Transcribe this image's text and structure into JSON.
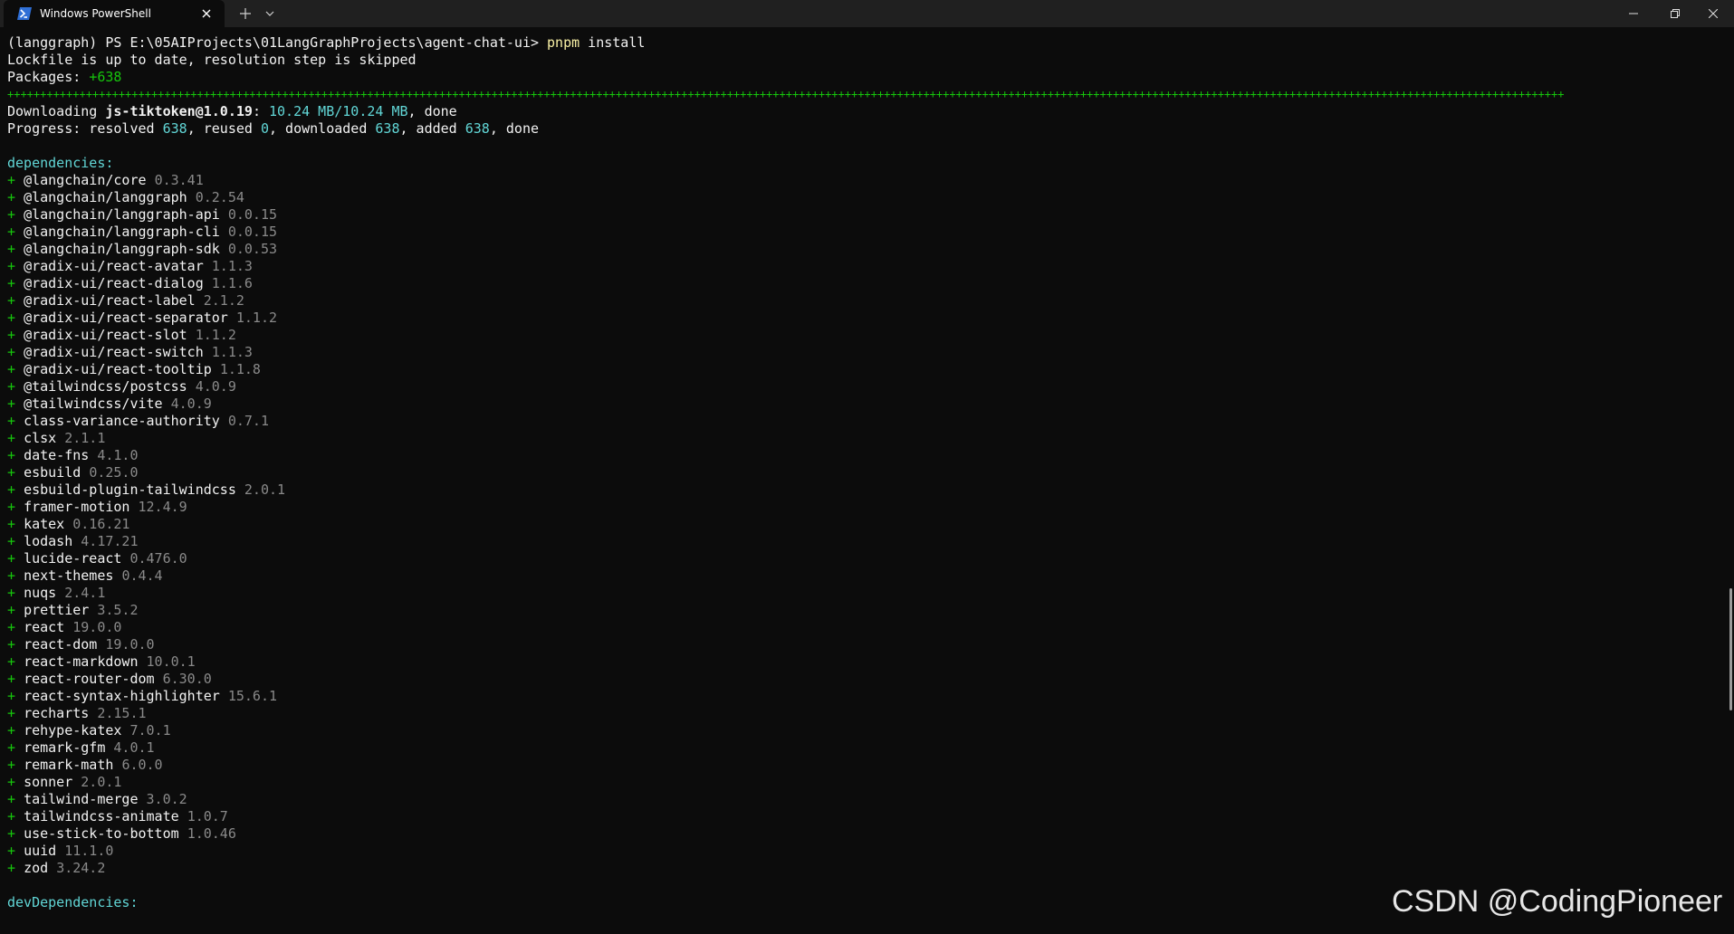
{
  "window": {
    "tab_title": "Windows PowerShell",
    "icons": {
      "tab": "powershell-icon",
      "close_tab": "close-icon",
      "new_tab": "plus-icon",
      "dropdown": "chevron-down-icon",
      "minimize": "minimize-icon",
      "maximize": "restore-icon",
      "close": "close-icon"
    }
  },
  "colors": {
    "background": "#0c0c0c",
    "titlebar": "#202020",
    "default_text": "#cccccc",
    "white_text": "#f2f2f2",
    "yellow": "#f9f1a5",
    "green": "#16c60c",
    "cyan": "#61d6d6",
    "dim": "#8a8a8a"
  },
  "terminal": {
    "prompt": "(langgraph) PS E:\\05AIProjects\\01LangGraphProjects\\agent-chat-ui> ",
    "command": "pnpm",
    "command_args": " install",
    "lockfile_line": "Lockfile is up to date, resolution step is skipped",
    "packages_label": "Packages: ",
    "packages_count": "+638",
    "plus_bar": "++++++++++++++++++++++++++++++++++++++++++++++++++++++++++++++++++++++++++++++++++++++++++++++++++++++++++++++++++++++++++++++++++++++++++++++++++++++++++++++++++++++++++++++++++++++++++++++++++++++++++++++++++++++++++++++++++++++++++++++",
    "downloading": {
      "label": "Downloading ",
      "package": "js-tiktoken@1.0.19",
      "sep": ": ",
      "progress": "10.24 MB/10.24 MB",
      "tail": ", done"
    },
    "progress_line": {
      "label": "Progress: resolved ",
      "resolved": "638",
      "reused_label": ", reused ",
      "reused": "0",
      "downloaded_label": ", downloaded ",
      "downloaded": "638",
      "added_label": ", added ",
      "added": "638",
      "tail": ", done"
    },
    "dependencies_header": "dependencies:",
    "dependencies": [
      {
        "name": "@langchain/core",
        "version": "0.3.41"
      },
      {
        "name": "@langchain/langgraph",
        "version": "0.2.54"
      },
      {
        "name": "@langchain/langgraph-api",
        "version": "0.0.15"
      },
      {
        "name": "@langchain/langgraph-cli",
        "version": "0.0.15"
      },
      {
        "name": "@langchain/langgraph-sdk",
        "version": "0.0.53"
      },
      {
        "name": "@radix-ui/react-avatar",
        "version": "1.1.3"
      },
      {
        "name": "@radix-ui/react-dialog",
        "version": "1.1.6"
      },
      {
        "name": "@radix-ui/react-label",
        "version": "2.1.2"
      },
      {
        "name": "@radix-ui/react-separator",
        "version": "1.1.2"
      },
      {
        "name": "@radix-ui/react-slot",
        "version": "1.1.2"
      },
      {
        "name": "@radix-ui/react-switch",
        "version": "1.1.3"
      },
      {
        "name": "@radix-ui/react-tooltip",
        "version": "1.1.8"
      },
      {
        "name": "@tailwindcss/postcss",
        "version": "4.0.9"
      },
      {
        "name": "@tailwindcss/vite",
        "version": "4.0.9"
      },
      {
        "name": "class-variance-authority",
        "version": "0.7.1"
      },
      {
        "name": "clsx",
        "version": "2.1.1"
      },
      {
        "name": "date-fns",
        "version": "4.1.0"
      },
      {
        "name": "esbuild",
        "version": "0.25.0"
      },
      {
        "name": "esbuild-plugin-tailwindcss",
        "version": "2.0.1"
      },
      {
        "name": "framer-motion",
        "version": "12.4.9"
      },
      {
        "name": "katex",
        "version": "0.16.21"
      },
      {
        "name": "lodash",
        "version": "4.17.21"
      },
      {
        "name": "lucide-react",
        "version": "0.476.0"
      },
      {
        "name": "next-themes",
        "version": "0.4.4"
      },
      {
        "name": "nuqs",
        "version": "2.4.1"
      },
      {
        "name": "prettier",
        "version": "3.5.2"
      },
      {
        "name": "react",
        "version": "19.0.0"
      },
      {
        "name": "react-dom",
        "version": "19.0.0"
      },
      {
        "name": "react-markdown",
        "version": "10.0.1"
      },
      {
        "name": "react-router-dom",
        "version": "6.30.0"
      },
      {
        "name": "react-syntax-highlighter",
        "version": "15.6.1"
      },
      {
        "name": "recharts",
        "version": "2.15.1"
      },
      {
        "name": "rehype-katex",
        "version": "7.0.1"
      },
      {
        "name": "remark-gfm",
        "version": "4.0.1"
      },
      {
        "name": "remark-math",
        "version": "6.0.0"
      },
      {
        "name": "sonner",
        "version": "2.0.1"
      },
      {
        "name": "tailwind-merge",
        "version": "3.0.2"
      },
      {
        "name": "tailwindcss-animate",
        "version": "1.0.7"
      },
      {
        "name": "use-stick-to-bottom",
        "version": "1.0.46"
      },
      {
        "name": "uuid",
        "version": "11.1.0"
      },
      {
        "name": "zod",
        "version": "3.24.2"
      }
    ],
    "dep_prefix": "+ ",
    "dev_dependencies_header": "devDependencies:"
  },
  "watermark": "CSDN @CodingPioneer"
}
